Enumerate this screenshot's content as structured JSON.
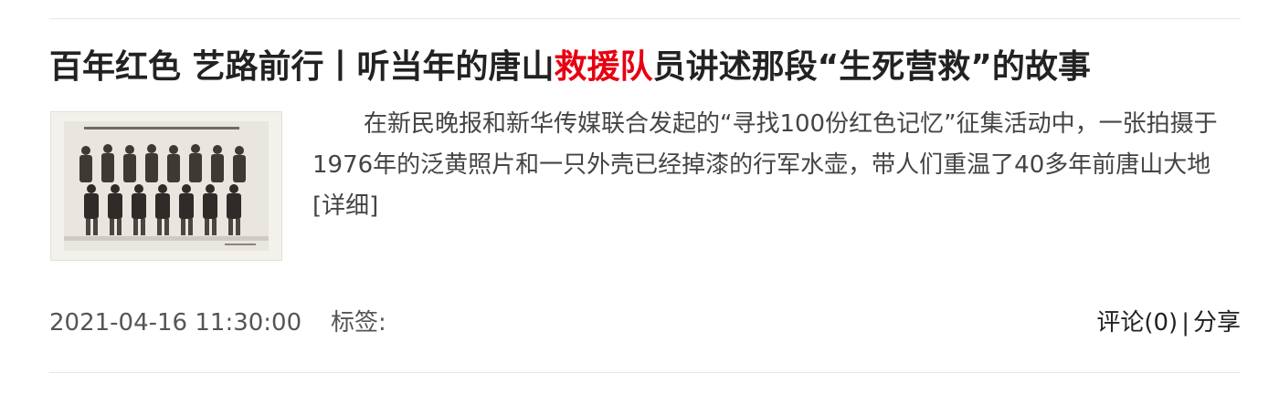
{
  "article": {
    "title_before": "百年红色 艺路前行丨听当年的唐山",
    "title_highlight": "救援队",
    "title_after": "员讲述那段“生死营救”的故事",
    "summary_text": "在新民晚报和新华传媒联合发起的“寻找100份红色记忆”征集活动中，一张拍摄于1976年的泛黄照片和一只外壳已经掉漆的行军水壶，带人们重温了40多年前唐山大地",
    "more_label": "[详细]",
    "date": "2021-04-16 11:30:00",
    "tags_label": "标签:",
    "comment_label": "评论(0)",
    "separator": "|",
    "share_label": "分享"
  },
  "colors": {
    "highlight": "#e60012",
    "text": "#222222",
    "muted": "#555555"
  }
}
